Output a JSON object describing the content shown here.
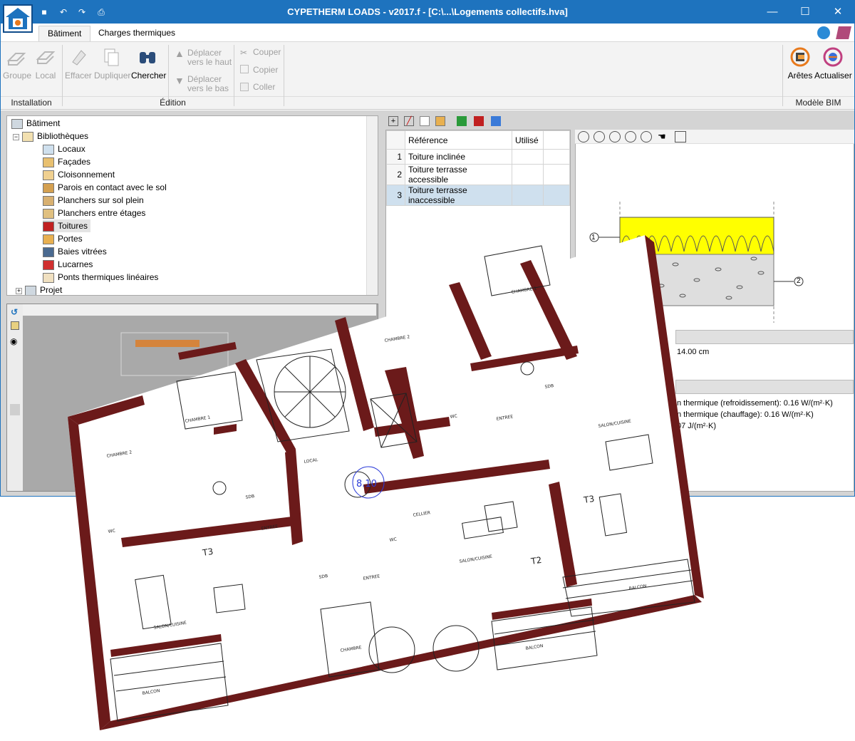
{
  "window": {
    "title": "CYPETHERM LOADS - v2017.f - [C:\\...\\Logements collectifs.hva]",
    "controls": {
      "minimize": "—",
      "maximize": "☐",
      "close": "✕"
    }
  },
  "tabs": [
    "Bâtiment",
    "Charges thermiques"
  ],
  "ribbon": {
    "installation": {
      "label": "Installation",
      "buttons": [
        "Groupe",
        "Local"
      ]
    },
    "edition": {
      "label": "Édition",
      "buttons": [
        "Effacer",
        "Dupliquer",
        "Chercher"
      ],
      "move_up": [
        "Déplacer",
        "vers le haut"
      ],
      "move_down": [
        "Déplacer",
        "vers le bas"
      ],
      "clipboard": [
        "Couper",
        "Copier",
        "Coller"
      ]
    },
    "bim": {
      "label": "Modèle BIM",
      "buttons": [
        "Arêtes",
        "Actualiser"
      ]
    }
  },
  "tree": {
    "root": "Bâtiment",
    "libraries": "Bibliothèques",
    "items": [
      "Locaux",
      "Façades",
      "Cloisonnement",
      "Parois en contact avec le sol",
      "Planchers sur sol plein",
      "Planchers entre étages",
      "Toitures",
      "Portes",
      "Baies vitrées",
      "Lucarnes",
      "Ponts thermiques linéaires"
    ],
    "selected": "Toitures",
    "project": "Projet"
  },
  "table": {
    "headers": [
      "Référence",
      "Utilisé"
    ],
    "rows": [
      {
        "n": "1",
        "ref": "Toiture inclinée"
      },
      {
        "n": "2",
        "ref": "Toiture terrasse accessible"
      },
      {
        "n": "3",
        "ref": "Toiture terrasse inaccessible"
      }
    ]
  },
  "detail": {
    "callouts": [
      "1",
      "2"
    ],
    "props": [
      "14.00 cm",
      "n thermique (refroidissement): 0.16 W/(m²·K)",
      "n thermique (chauffage): 0.16 W/(m²·K)",
      "07 J/(m²·K)"
    ]
  },
  "plan": {
    "labels": [
      "CHAMBRE 1",
      "CHAMBRE 2",
      "CHAMBRE 1",
      "CHAMBRE 2",
      "SDB",
      "LOCAL",
      "WC",
      "ENTREE",
      "SALON/CUISINE",
      "T3",
      "WC",
      "ENTREE",
      "SDB",
      "ENTREE",
      "CELLIER",
      "SALON/CUISINE",
      "T2",
      "SALON/CUISINE",
      "T3",
      "SDB",
      "BALCON",
      "CHAMBRE",
      "BALCON",
      "BALCON",
      "WC"
    ],
    "level": "8.10"
  }
}
